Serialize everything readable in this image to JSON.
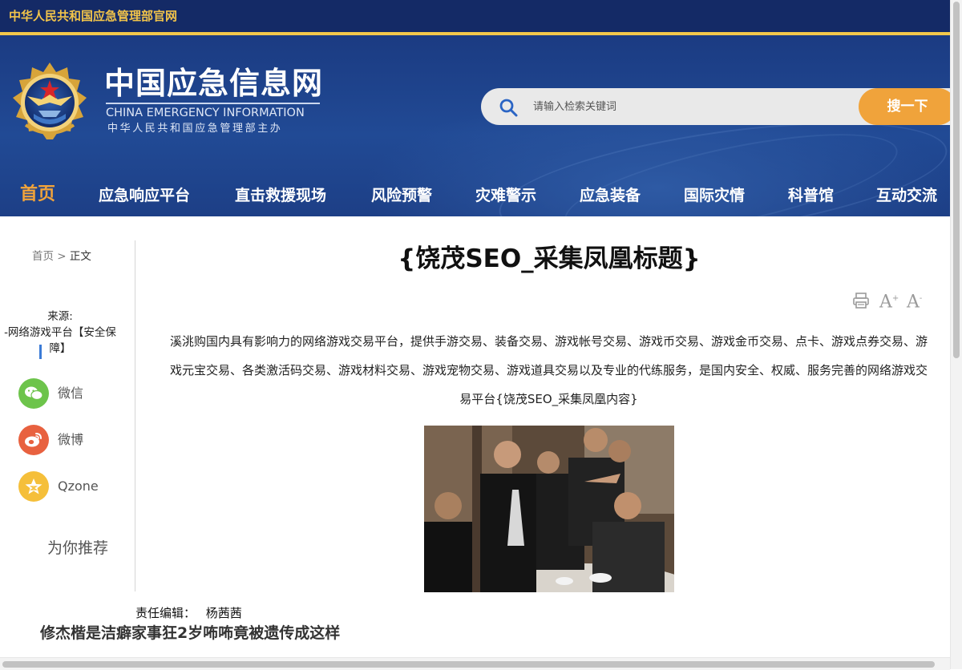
{
  "topbar": {
    "site_name": "中华人民共和国应急管理部官网"
  },
  "header": {
    "logo_cn": "中国应急信息网",
    "logo_en": "CHINA EMERGENCY INFORMATION",
    "logo_sub": "中华人民共和国应急管理部主办",
    "emblem_icon": "ministry-emblem-icon"
  },
  "search": {
    "placeholder": "请输入检索关键词",
    "value": "",
    "button_label": "搜一下",
    "icon": "search-icon"
  },
  "nav": {
    "items": [
      {
        "label": "首页",
        "active": true
      },
      {
        "label": "应急响应平台",
        "active": false
      },
      {
        "label": "直击救援现场",
        "active": false
      },
      {
        "label": "风险预警",
        "active": false
      },
      {
        "label": "灾难警示",
        "active": false
      },
      {
        "label": "应急装备",
        "active": false
      },
      {
        "label": "国际灾情",
        "active": false
      },
      {
        "label": "科普馆",
        "active": false
      },
      {
        "label": "互动交流",
        "active": false
      }
    ]
  },
  "breadcrumb": {
    "home": "首页",
    "sep": ">",
    "current": "正文"
  },
  "source": {
    "label": "来源:",
    "value": "-网络游戏平台【安全保障】"
  },
  "share": [
    {
      "label": "微信",
      "icon": "wechat-icon",
      "color": "#6dc44b"
    },
    {
      "label": "微博",
      "icon": "weibo-icon",
      "color": "#e8613f"
    },
    {
      "label": "Qzone",
      "icon": "qzone-icon",
      "color": "#f5bf3a"
    }
  ],
  "recommend_label": "为你推荐",
  "article": {
    "title": "{饶茂SEO_采集凤凰标题}",
    "tools": {
      "print_icon": "print-icon",
      "font_larger": "A",
      "font_smaller": "A"
    },
    "body": "溪洮购国内具有影响力的网络游戏交易平台，提供手游交易、装备交易、游戏帐号交易、游戏币交易、游戏金币交易、点卡、游戏点券交易、游戏元宝交易、各类激活码交易、游戏材料交易、游戏宠物交易、游戏道具交易以及专业的代练服务，是国内安全、权威、服务完善的网络游戏交易平台{饶茂SEO_采集凤凰内容}",
    "editor_label": "责任编辑：",
    "editor_name": "杨茜茜"
  },
  "related_headline": "修杰楷是洁癖家事狂2岁咘咘竟被遗传成这样",
  "colors": {
    "topbar_bg": "#142a66",
    "accent_gold": "#f2c84b",
    "banner_blue": "#214a95",
    "search_button": "#f0a33b",
    "nav_active": "#f0a33b"
  }
}
